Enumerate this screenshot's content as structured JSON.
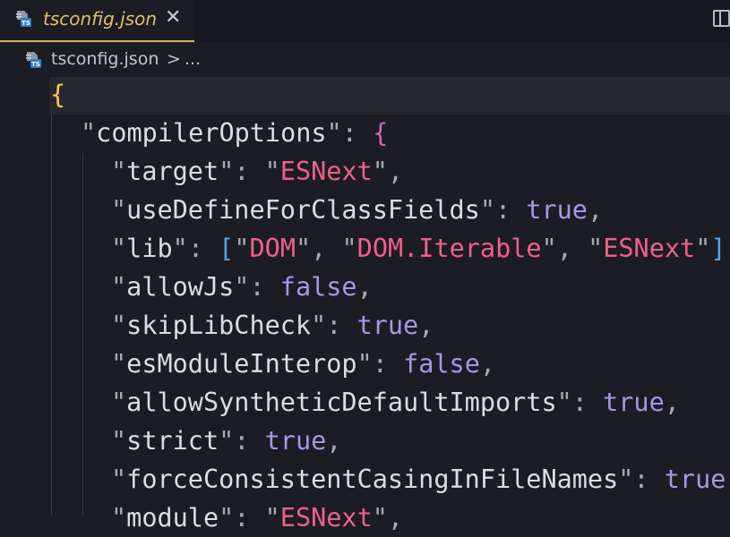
{
  "tab": {
    "title": "tsconfig.json",
    "close": "✕",
    "icon": "ts-file-icon"
  },
  "breadcrumb": {
    "file": "tsconfig.json",
    "separator": ">",
    "more": "..."
  },
  "editor": {
    "open_brace": "{",
    "compiler_key": "compilerOptions",
    "compiler_open": "{",
    "options": {
      "target": {
        "key": "target",
        "value": "ESNext"
      },
      "useDefine": {
        "key": "useDefineForClassFields",
        "value": "true"
      },
      "lib": {
        "key": "lib",
        "values": [
          "DOM",
          "DOM.Iterable",
          "ESNext"
        ]
      },
      "allowJs": {
        "key": "allowJs",
        "value": "false"
      },
      "skipLibCheck": {
        "key": "skipLibCheck",
        "value": "true"
      },
      "esModuleInterop": {
        "key": "esModuleInterop",
        "value": "false"
      },
      "allowSynthetic": {
        "key": "allowSyntheticDefaultImports",
        "value": "true"
      },
      "strict": {
        "key": "strict",
        "value": "true"
      },
      "forceConsistent": {
        "key": "forceConsistentCasingInFileNames",
        "value": "true"
      },
      "module": {
        "key": "module",
        "value": "ESNext"
      }
    }
  },
  "colors": {
    "tab_accent": "#d8b55e",
    "string": "#f0608a",
    "boolean": "#a996e6",
    "key": "#dcdde3",
    "brace_outer": "#f1cc4c",
    "brace_inner": "#d065b8",
    "bracket": "#56a0ea"
  }
}
